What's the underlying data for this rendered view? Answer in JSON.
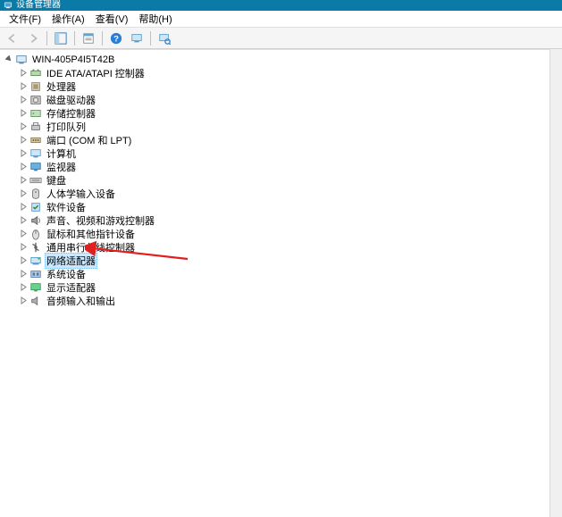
{
  "window": {
    "title": "设备管理器"
  },
  "menu": {
    "file": "文件(F)",
    "action": "操作(A)",
    "view": "查看(V)",
    "help": "帮助(H)"
  },
  "toolbar": {
    "back": "back",
    "forward": "forward",
    "show_hide": "show-hide-console-tree",
    "properties": "properties",
    "help": "help",
    "refresh": "刷新",
    "scan": "scan-hardware"
  },
  "tree": {
    "root": {
      "label": "WIN-405P4I5T42B"
    },
    "items": [
      {
        "id": "ide",
        "label": "IDE ATA/ATAPI 控制器",
        "icon": "controller"
      },
      {
        "id": "cpu",
        "label": "处理器",
        "icon": "cpu"
      },
      {
        "id": "disk",
        "label": "磁盘驱动器",
        "icon": "disk"
      },
      {
        "id": "storage",
        "label": "存储控制器",
        "icon": "storage"
      },
      {
        "id": "printq",
        "label": "打印队列",
        "icon": "printer"
      },
      {
        "id": "ports",
        "label": "端口 (COM 和 LPT)",
        "icon": "port"
      },
      {
        "id": "computer",
        "label": "计算机",
        "icon": "computer"
      },
      {
        "id": "monitor",
        "label": "监视器",
        "icon": "monitor"
      },
      {
        "id": "keyboard",
        "label": "键盘",
        "icon": "keyboard"
      },
      {
        "id": "hid",
        "label": "人体学输入设备",
        "icon": "hid"
      },
      {
        "id": "softdev",
        "label": "软件设备",
        "icon": "software"
      },
      {
        "id": "audio",
        "label": "声音、视频和游戏控制器",
        "icon": "audio"
      },
      {
        "id": "mouse",
        "label": "鼠标和其他指针设备",
        "icon": "mouse"
      },
      {
        "id": "usb",
        "label": "通用串行总线控制器",
        "icon": "usb"
      },
      {
        "id": "network",
        "label": "网络适配器",
        "icon": "network",
        "selected": true
      },
      {
        "id": "system",
        "label": "系统设备",
        "icon": "system"
      },
      {
        "id": "display",
        "label": "显示适配器",
        "icon": "display"
      },
      {
        "id": "audioio",
        "label": "音频输入和输出",
        "icon": "audioio"
      }
    ]
  },
  "annotation": {
    "color": "#e02020"
  }
}
